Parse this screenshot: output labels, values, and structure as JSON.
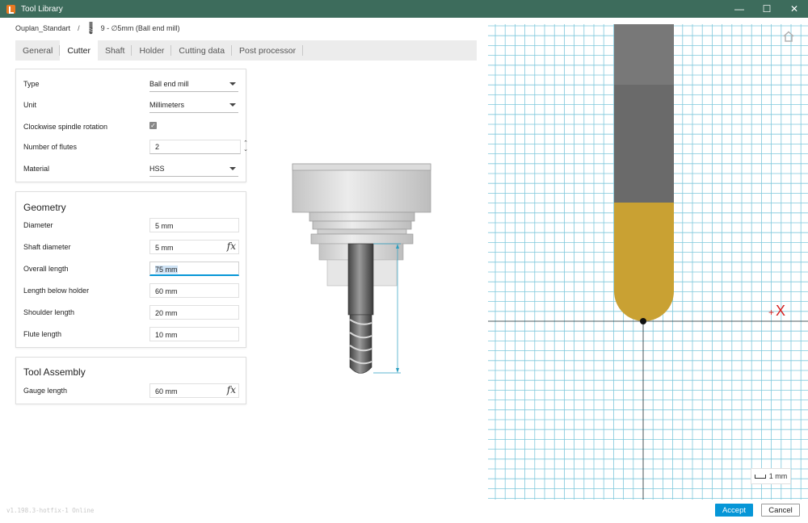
{
  "window": {
    "title": "Tool Library",
    "controls": [
      "—",
      "☐",
      "✕"
    ]
  },
  "breadcrumb": {
    "library": "Ouplan_Standart",
    "separator": "/",
    "tool": "9 - ∅5mm (Ball end mill)"
  },
  "tabs": [
    {
      "label": "General",
      "active": false
    },
    {
      "label": "Cutter",
      "active": true
    },
    {
      "label": "Shaft",
      "active": false
    },
    {
      "label": "Holder",
      "active": false
    },
    {
      "label": "Cutting data",
      "active": false
    },
    {
      "label": "Post processor",
      "active": false
    }
  ],
  "cutter": {
    "type": {
      "label": "Type",
      "value": "Ball end mill"
    },
    "unit": {
      "label": "Unit",
      "value": "Millimeters"
    },
    "clockwise": {
      "label": "Clockwise spindle rotation",
      "checked": true,
      "mark": "✓"
    },
    "flutes": {
      "label": "Number of flutes",
      "value": "2",
      "up": "⌃",
      "down": "⌄"
    },
    "material": {
      "label": "Material",
      "value": "HSS"
    }
  },
  "geometry": {
    "title": "Geometry",
    "diameter": {
      "label": "Diameter",
      "value": "5 mm"
    },
    "shaft_diameter": {
      "label": "Shaft diameter",
      "value": "5 mm",
      "fx": "fx"
    },
    "overall_length": {
      "label": "Overall length",
      "value": "75 mm"
    },
    "length_below_holder": {
      "label": "Length below holder",
      "value": "60 mm"
    },
    "shoulder_length": {
      "label": "Shoulder length",
      "value": "20 mm"
    },
    "flute_length": {
      "label": "Flute length",
      "value": "10 mm"
    }
  },
  "assembly": {
    "title": "Tool Assembly",
    "gauge_length": {
      "label": "Gauge length",
      "value": "60 mm",
      "fx": "fx"
    }
  },
  "viewport": {
    "axis_plus": "+",
    "axis_label": "X",
    "scale_label": "1 mm",
    "grid_color": "#7ec8dc",
    "shank_color": "#6e6e6e",
    "flute_color": "#c9a133"
  },
  "footer": {
    "version": "v1.198.3-hotfix-1 Online",
    "accept": "Accept",
    "cancel": "Cancel"
  },
  "colors": {
    "titlebar": "#3d6c5c",
    "accent": "#0696d7"
  }
}
